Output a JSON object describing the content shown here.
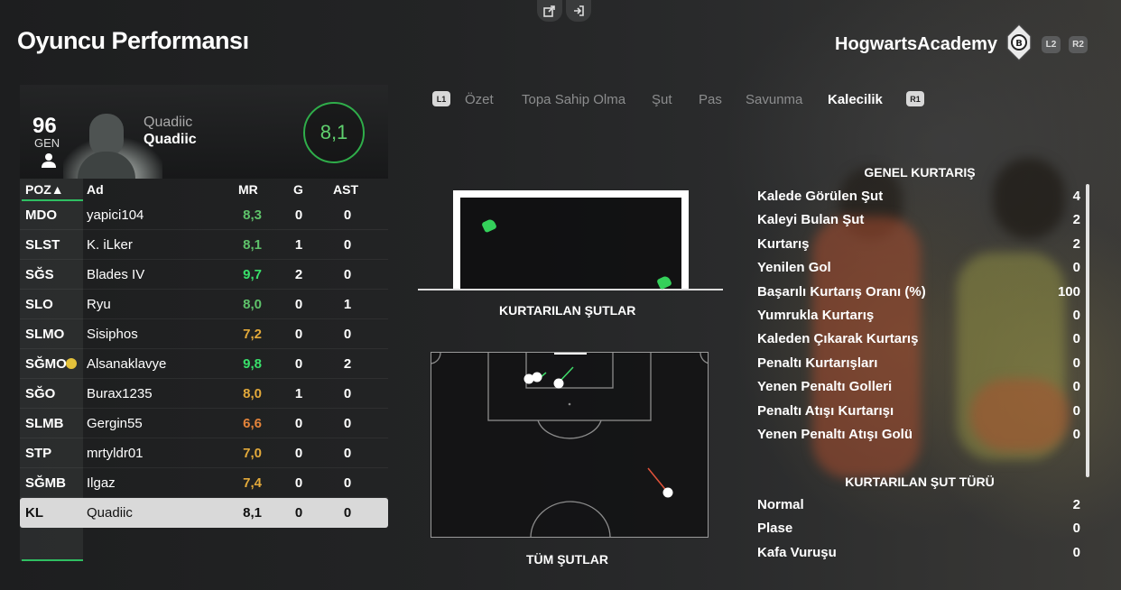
{
  "page": {
    "title": "Oyuncu Performansı"
  },
  "top_icons": [
    "share-icon",
    "exit-icon"
  ],
  "club": {
    "name": "HogwartsAcademy",
    "buttons": [
      "L2",
      "R2"
    ]
  },
  "player": {
    "gen_value": "96",
    "gen_label": "GEN",
    "first_name": "Quadiic",
    "last_name": "Quadiic",
    "rating": "8,1"
  },
  "table": {
    "headers": {
      "poz": "POZ▲",
      "ad": "Ad",
      "mr": "MR",
      "g": "G",
      "ast": "AST"
    },
    "rows": [
      {
        "pos": "MDO",
        "name": "yapici104",
        "mr": "8,3",
        "mr_color": "#5ec26a",
        "g": "0",
        "ast": "0"
      },
      {
        "pos": "SLST",
        "name": "K. iLker",
        "mr": "8,1",
        "mr_color": "#5ec26a",
        "g": "1",
        "ast": "0"
      },
      {
        "pos": "SĞS",
        "name": "Blades IV",
        "mr": "9,7",
        "mr_color": "#39e06a",
        "g": "2",
        "ast": "0"
      },
      {
        "pos": "SLO",
        "name": "Ryu",
        "mr": "8,0",
        "mr_color": "#5ec26a",
        "g": "0",
        "ast": "1"
      },
      {
        "pos": "SLMO",
        "name": "Sisiphos",
        "mr": "7,2",
        "mr_color": "#e2a93a",
        "g": "0",
        "ast": "0"
      },
      {
        "pos": "SĞMO",
        "name": "Alsanaklavye",
        "mr": "9,8",
        "mr_color": "#39e06a",
        "g": "0",
        "ast": "2"
      },
      {
        "pos": "SĞO",
        "name": "Burax1235",
        "mr": "8,0",
        "mr_color": "#e2a93a",
        "g": "1",
        "ast": "0"
      },
      {
        "pos": "SLMB",
        "name": "Gergin55",
        "mr": "6,6",
        "mr_color": "#e4843a",
        "g": "0",
        "ast": "0"
      },
      {
        "pos": "STP",
        "name": "mrtyldr01",
        "mr": "7,0",
        "mr_color": "#e2a93a",
        "g": "0",
        "ast": "0"
      },
      {
        "pos": "SĞMB",
        "name": "Ilgaz",
        "mr": "7,4",
        "mr_color": "#e2a93a",
        "g": "0",
        "ast": "0"
      },
      {
        "pos": "KL",
        "name": "Quadiic",
        "mr": "8,1",
        "mr_color": "#111111",
        "g": "0",
        "ast": "0"
      }
    ]
  },
  "tabs": {
    "left_chip": "L1",
    "right_chip": "R1",
    "items": [
      "Özet",
      "Topa Sahip Olma",
      "Şut",
      "Pas",
      "Savunma",
      "Kalecilik"
    ],
    "active": "Kalecilik"
  },
  "goal_section": {
    "label": "KURTARILAN ŞUTLAR"
  },
  "pitch_section": {
    "label": "TÜM ŞUTLAR"
  },
  "stats": {
    "general_header": "GENEL KURTARIŞ",
    "general": [
      {
        "label": "Kalede Görülen Şut",
        "value": "4"
      },
      {
        "label": "Kaleyi Bulan Şut",
        "value": "2"
      },
      {
        "label": "Kurtarış",
        "value": "2"
      },
      {
        "label": "Yenilen Gol",
        "value": "0"
      },
      {
        "label": "Başarılı Kurtarış Oranı (%)",
        "value": "100"
      },
      {
        "label": "Yumrukla Kurtarış",
        "value": "0"
      },
      {
        "label": "Kaleden Çıkarak Kurtarış",
        "value": "0"
      },
      {
        "label": "Penaltı Kurtarışları",
        "value": "0"
      },
      {
        "label": "Yenen Penaltı Golleri",
        "value": "0"
      },
      {
        "label": "Penaltı Atışı Kurtarışı",
        "value": "0"
      },
      {
        "label": "Yenen Penaltı Atışı Golü",
        "value": "0"
      }
    ],
    "type_header": "KURTARILAN ŞUT TÜRÜ",
    "types": [
      {
        "label": "Normal",
        "value": "2"
      },
      {
        "label": "Plase",
        "value": "0"
      },
      {
        "label": "Kafa Vuruşu",
        "value": "0"
      }
    ]
  },
  "colors": {
    "accent_green": "#2fbf62",
    "rating_green": "#5fd06e",
    "orange": "#e2a93a"
  }
}
